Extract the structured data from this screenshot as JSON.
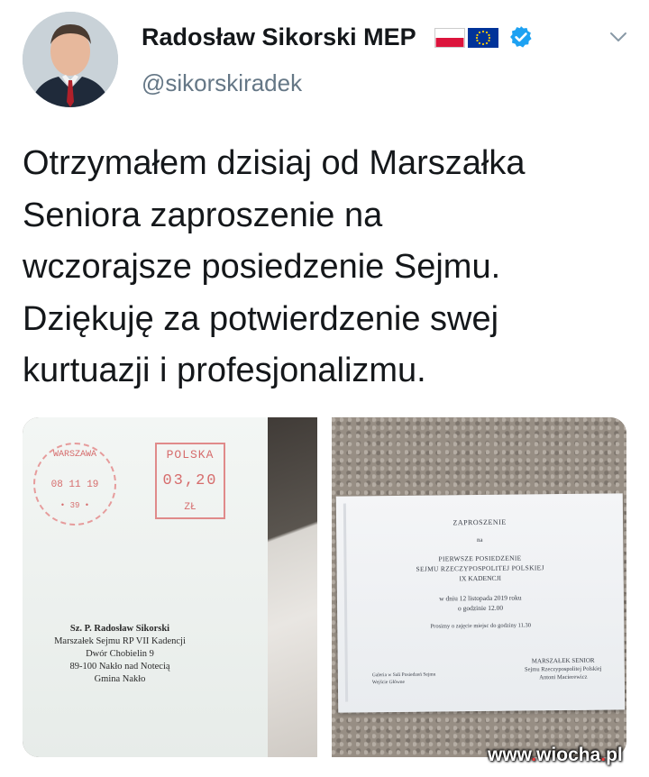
{
  "tweet": {
    "author_name": "Radosław Sikorski MEP",
    "handle": "@sikorskiradek",
    "text": "Otrzymałem dzisiaj od Marszałka\nSeniora zaproszenie na\nwczorajsze posiedzenie Sejmu.\nDziękuję za potwierdzenie swej\nkurtuazji i profesjonalizmu.",
    "badges": [
      "flag-poland",
      "flag-eu",
      "verified-badge-icon"
    ],
    "menu_icon": "chevron-down-icon",
    "verified_color": "#1da1f2"
  },
  "photo_left": {
    "stamp": {
      "country": "POLSKA",
      "amount": "03,20",
      "currency": "ZŁ"
    },
    "postmark": {
      "city": "WARSZAWA",
      "date": "08 11 19",
      "code": "• 39 •"
    },
    "address": [
      "Sz. P. Radosław Sikorski",
      "Marszałek Sejmu RP VII Kadencji",
      "Dwór Chobielin 9",
      "89-100 Nakło nad Notecią",
      "Gmina Nakło"
    ]
  },
  "photo_right": {
    "title": "ZAPROSZENIE",
    "na": "na",
    "line1": "PIERWSZE POSIEDZENIE",
    "line2": "SEJMU RZECZYPOSPOLITEJ POLSKIEJ",
    "line3": "IX KADENCJI",
    "date": "w dniu 12 listopada 2019 roku",
    "time": "o godzinie 12.00",
    "request": "Prosimy o zajęcie miejsc do godziny 11.30",
    "signer_title": "MARSZAŁEK SENIOR",
    "signer_org": "Sejmu Rzeczypospolitej Polskiej",
    "signer_name": "Antoni Macierewicz",
    "gallery_line1": "Galeria w Sali Posiedzeń Sejmu",
    "gallery_line2": "Wejście Główne"
  },
  "watermark": {
    "prefix": "www",
    "dot1": ".",
    "name": "wiocha",
    "dot2": ".",
    "tld": "pl"
  }
}
